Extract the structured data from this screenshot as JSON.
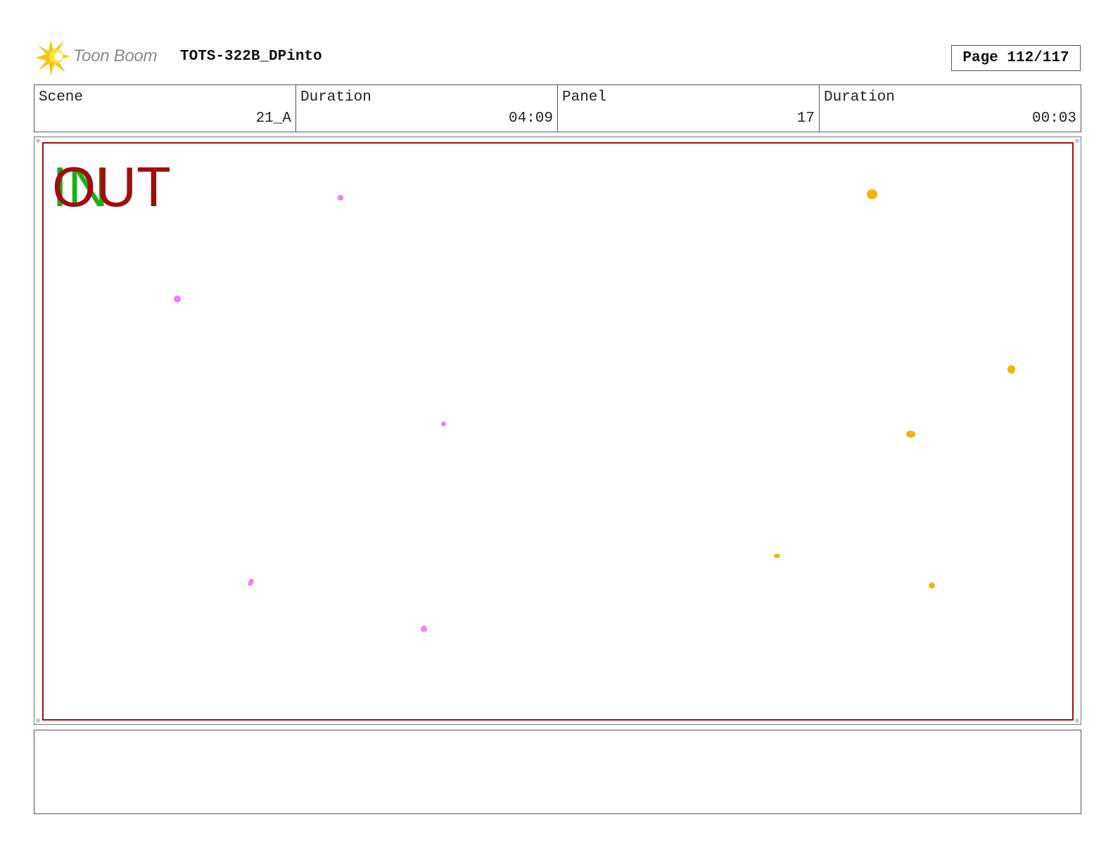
{
  "header": {
    "logo_text": "Toon Boom",
    "title": "TOTS-322B_DPinto",
    "page_indicator": "Page 112/117"
  },
  "info": {
    "scene_label": "Scene",
    "scene_value": "21_A",
    "scene_duration_label": "Duration",
    "scene_duration_value": "04:09",
    "panel_label": "Panel",
    "panel_value": "17",
    "panel_duration_label": "Duration",
    "panel_duration_value": "00:03"
  },
  "panel": {
    "in_label": "IN",
    "out_label": "OUT"
  },
  "colors": {
    "safe_frame": "#9c1010",
    "in_text": "#17b017",
    "out_text": "#a30c0c",
    "pink_marks": "#ec80ee",
    "yellow_marks": "#f5b106"
  },
  "notes": {
    "text": ""
  }
}
